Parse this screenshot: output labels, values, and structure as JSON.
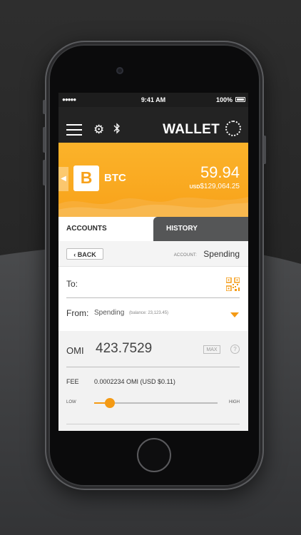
{
  "status_bar": {
    "signal": "●●●●●",
    "time": "9:41 AM",
    "battery": "100%"
  },
  "navbar": {
    "title": "WALLET"
  },
  "hero": {
    "coin_symbol": "B",
    "coin": "BTC",
    "balance": "59.94",
    "usd_prefix": "USD",
    "usd_balance": "$129,064.25"
  },
  "tabs": {
    "accounts": "ACCOUNTS",
    "history": "HISTORY"
  },
  "subbar": {
    "back": "‹ BACK",
    "account_label": "ACCOUNT:",
    "account_value": "Spending"
  },
  "form": {
    "to_label": "To:",
    "from_label": "From:",
    "from_value": "Spending",
    "from_balance": "(balance: 23,123.45)",
    "amount_unit": "OMI",
    "amount_value": "423.7529",
    "max_label": "MAX",
    "help_symbol": "?",
    "fee_label": "FEE",
    "fee_value": "0.0002234 OMI  (USD $0.11)",
    "slider_low": "LOW",
    "slider_high": "HIGH",
    "slider_level": 0.13
  },
  "colors": {
    "accent": "#f49a14",
    "navbar": "#232323",
    "hero": "#f9a81f"
  }
}
